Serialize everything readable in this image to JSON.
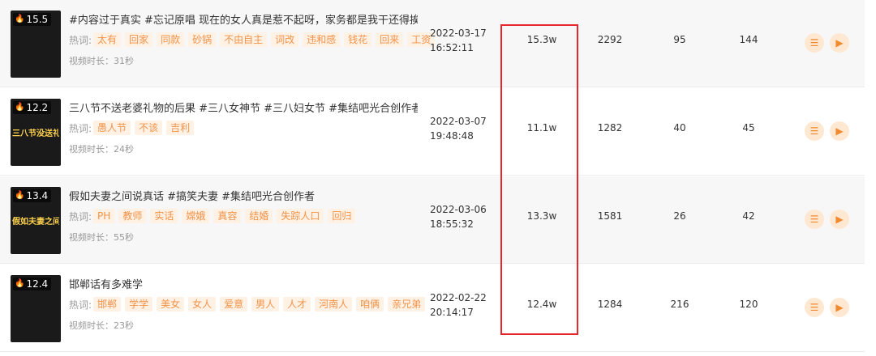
{
  "rows": [
    {
      "hot": "15.5",
      "cover_text": "",
      "title": "#内容过于真实 #忘记原唱 现在的女人真是惹不起呀，家务都是我干还得挨打",
      "keyword_label": "热词:",
      "keywords": [
        "太有",
        "回家",
        "同款",
        "砂锅",
        "不由自主",
        "词改",
        "违和感",
        "钱花",
        "回来",
        "工资"
      ],
      "duration": "视频时长：31秒",
      "date": "2022-03-17",
      "time": "16:52:11",
      "plays": "15.3w",
      "likes": "2292",
      "comments": "95",
      "shares": "144"
    },
    {
      "hot": "12.2",
      "cover_text": "三八节没送礼物",
      "title": "三八节不送老婆礼物的后果 #三八女神节 #三八妇女节 #集结吧光合创作者",
      "keyword_label": "热词:",
      "keywords": [
        "愚人节",
        "不该",
        "吉利"
      ],
      "duration": "视频时长：24秒",
      "date": "2022-03-07",
      "time": "19:48:48",
      "plays": "11.1w",
      "likes": "1282",
      "comments": "40",
      "shares": "45"
    },
    {
      "hot": "13.4",
      "cover_text": "假如夫妻之间说真话",
      "title": "假如夫妻之间说真话 #搞笑夫妻 #集结吧光合创作者",
      "keyword_label": "热词:",
      "keywords": [
        "PH",
        "教师",
        "实话",
        "嫦娥",
        "真容",
        "结婚",
        "失踪人口",
        "回归"
      ],
      "duration": "视频时长：55秒",
      "date": "2022-03-06",
      "time": "18:55:32",
      "plays": "13.3w",
      "likes": "1581",
      "comments": "26",
      "shares": "42"
    },
    {
      "hot": "12.4",
      "cover_text": "",
      "title": "邯郸话有多难学",
      "keyword_label": "热词:",
      "keywords": [
        "邯郸",
        "学学",
        "美女",
        "女人",
        "爱意",
        "男人",
        "人才",
        "河南人",
        "咱俩",
        "亲兄弟"
      ],
      "duration": "视频时长：23秒",
      "date": "2022-02-22",
      "time": "20:14:17",
      "plays": "12.4w",
      "likes": "1284",
      "comments": "216",
      "shares": "120"
    }
  ],
  "icons": {
    "hot": "flame-icon",
    "detail": "list-icon",
    "play": "play-icon"
  },
  "colors": {
    "accent": "#f08a2e",
    "tag_bg": "#fff1e4",
    "highlight": "#e8262d"
  }
}
